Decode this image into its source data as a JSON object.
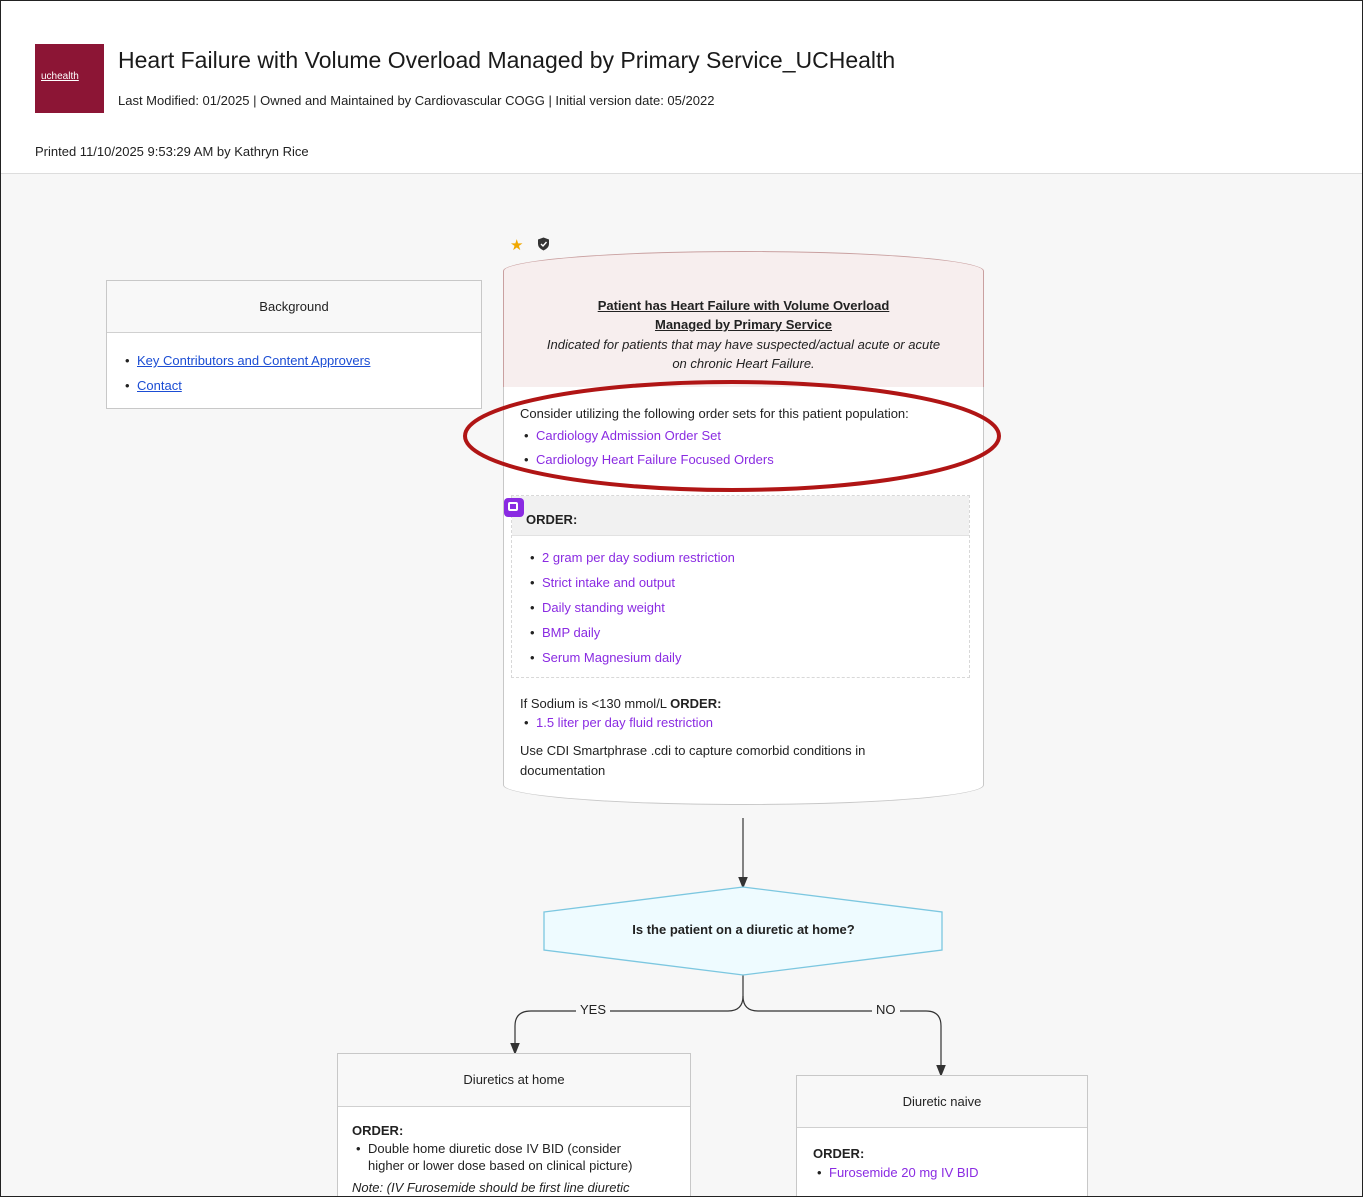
{
  "header": {
    "logo_text": "uchealth",
    "title": "Heart Failure with Volume Overload Managed by Primary Service_UCHealth",
    "meta": "Last Modified: 01/2025 | Owned and Maintained by Cardiovascular COGG | Initial version date: 05/2022",
    "printed": "Printed 11/10/2025 9:53:29 AM by Kathryn Rice"
  },
  "background_box": {
    "title": "Background",
    "links": [
      "Key Contributors and Content Approvers",
      "Contact"
    ]
  },
  "main_card": {
    "title_line1": "Patient has Heart Failure with Volume Overload",
    "title_line2": "Managed by Primary Service",
    "subtitle_line1": "Indicated for patients that may have suspected/actual acute or acute",
    "subtitle_line2": "on chronic Heart Failure.",
    "order_sets_intro": "Consider utilizing the following order sets for this patient population:",
    "order_sets": [
      "Cardiology Admission Order Set",
      "Cardiology Heart Failure Focused Orders"
    ],
    "order_label": "ORDER:",
    "orders": [
      "2 gram per day sodium restriction",
      "Strict intake and output",
      "Daily standing weight",
      "BMP daily",
      "Serum Magnesium daily"
    ],
    "sodium_prefix": "If Sodium is <130 mmol/L ",
    "sodium_order": "ORDER:",
    "sodium_items": [
      "1.5 liter per day fluid restriction"
    ],
    "cdi_line1": "Use CDI Smartphrase .cdi to capture comorbid conditions in",
    "cdi_line2": "documentation"
  },
  "decision": {
    "question": "Is the patient on a diuretic at home?",
    "yes_label": "YES",
    "no_label": "NO"
  },
  "diuretics_home": {
    "title": "Diuretics at home",
    "order_label": "ORDER:",
    "item_line1": "Double home diuretic dose IV BID (consider",
    "item_line2": "higher or lower dose based on clinical picture)",
    "note": "Note: (IV Furosemide should be first line diuretic"
  },
  "diuretic_naive": {
    "title": "Diuretic naive",
    "order_label": "ORDER:",
    "items": [
      "Furosemide 20 mg IV BID"
    ]
  },
  "colors": {
    "brand": "#8c1535",
    "link_blue": "#1b4dd4",
    "order_purple": "#8a2be2",
    "highlight_ellipse": "#b01515",
    "decision_fill": "#eefbff",
    "decision_stroke": "#7cc7e0"
  }
}
